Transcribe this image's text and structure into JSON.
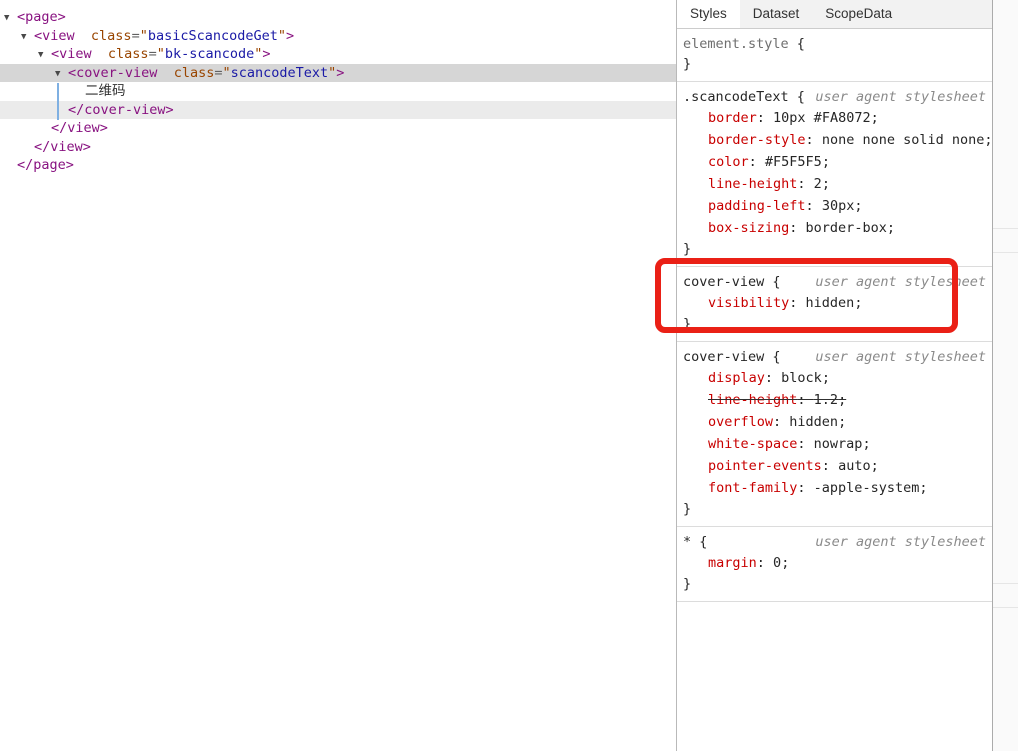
{
  "elements_panel": {
    "nodes": [
      {
        "type": "open",
        "tag": "page",
        "level": 0,
        "expanded": true
      },
      {
        "type": "open",
        "tag": "view",
        "level": 1,
        "expanded": true,
        "attr_name": "class",
        "attr_value": "basicScancodeGet"
      },
      {
        "type": "open",
        "tag": "view",
        "level": 2,
        "expanded": true,
        "attr_name": "class",
        "attr_value": "bk-scancode"
      },
      {
        "type": "open",
        "tag": "cover-view",
        "level": 3,
        "expanded": true,
        "attr_name": "class",
        "attr_value": "scancodeText",
        "selected": true
      },
      {
        "type": "text",
        "text": "二维码",
        "level": 4
      },
      {
        "type": "close",
        "tag": "cover-view",
        "level": 3,
        "selected_secondary": true
      },
      {
        "type": "close",
        "tag": "view",
        "level": 2
      },
      {
        "type": "close",
        "tag": "view",
        "level": 1
      },
      {
        "type": "close",
        "tag": "page",
        "level": 0
      }
    ]
  },
  "styles_panel": {
    "tabs": [
      {
        "label": "Styles",
        "active": true
      },
      {
        "label": "Dataset",
        "active": false
      },
      {
        "label": "ScopeData",
        "active": false
      }
    ],
    "sections": [
      {
        "selector": "element.style",
        "selector_gray": true,
        "origin": "",
        "declarations": []
      },
      {
        "selector": ".scancodeText",
        "origin": "user agent stylesheet",
        "declarations": [
          {
            "property": "border",
            "value": "10px #FA8072"
          },
          {
            "property": "border-style",
            "value": "none none solid none"
          },
          {
            "property": "color",
            "value": "#F5F5F5"
          },
          {
            "property": "line-height",
            "value": "2"
          },
          {
            "property": "padding-left",
            "value": "30px"
          },
          {
            "property": "box-sizing",
            "value": "border-box"
          }
        ]
      },
      {
        "selector": "cover-view",
        "origin": "user agent stylesheet",
        "highlighted": true,
        "declarations": [
          {
            "property": "visibility",
            "value": "hidden"
          }
        ]
      },
      {
        "selector": "cover-view",
        "origin": "user agent stylesheet",
        "declarations": [
          {
            "property": "display",
            "value": "block"
          },
          {
            "property": "line-height",
            "value": "1.2",
            "struck": true
          },
          {
            "property": "overflow",
            "value": "hidden"
          },
          {
            "property": "white-space",
            "value": "nowrap"
          },
          {
            "property": "pointer-events",
            "value": "auto"
          },
          {
            "property": "font-family",
            "value": "-apple-system"
          }
        ]
      },
      {
        "selector": "*",
        "origin": "user agent stylesheet",
        "declarations": [
          {
            "property": "margin",
            "value": "0"
          }
        ]
      }
    ]
  },
  "annotation": {
    "shape": "red-rounded-rectangle",
    "highlights": "cover-view { visibility: hidden; } rule",
    "color": "#EA2016"
  },
  "colors": {
    "tag": "#881280",
    "attribute_name": "#994500",
    "attribute_value": "#1A1AA6",
    "property_name": "#C80000",
    "selected_row": "#D6D6D6",
    "guide_line": "#7FB0E2"
  }
}
